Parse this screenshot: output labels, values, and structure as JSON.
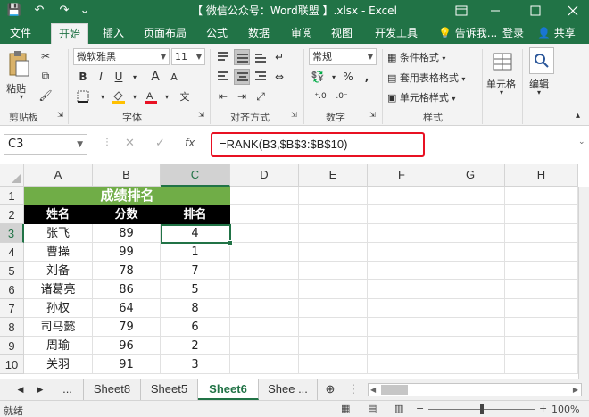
{
  "titlebar": {
    "title": "【 微信公众号：Word联盟 】.xlsx - Excel",
    "qa_save": "💾",
    "qa_undo": "↶",
    "qa_redo": "↷",
    "qa_custom": "⌄"
  },
  "tabs": [
    "文件",
    "开始",
    "插入",
    "页面布局",
    "公式",
    "数据",
    "审阅",
    "视图",
    "开发工具"
  ],
  "active_tab": "开始",
  "tell_me": "告诉我...",
  "login": "登录",
  "share": "共享",
  "ribbon": {
    "clipboard": {
      "paste": "粘贴",
      "label": "剪贴板"
    },
    "font": {
      "name": "微软雅黑",
      "size": "11",
      "label": "字体"
    },
    "alignment": {
      "label": "对齐方式"
    },
    "number": {
      "format": "常规",
      "percent": "%",
      "comma": ",",
      "label": "数字"
    },
    "styles": {
      "conditional": "条件格式",
      "table": "套用表格格式",
      "cell_styles": "单元格样式",
      "label": "样式"
    },
    "cells": {
      "label": "单元格"
    },
    "editing": {
      "label": "编辑"
    }
  },
  "formula_bar": {
    "name_box": "C3",
    "formula": "=RANK(B3,$B$3:$B$10)",
    "fx": "fx",
    "cancel": "✕",
    "enter": "✓"
  },
  "columns": [
    "A",
    "B",
    "C",
    "D",
    "E",
    "F",
    "G",
    "H"
  ],
  "rows": [
    "1",
    "2",
    "3",
    "4",
    "5",
    "6",
    "7",
    "8",
    "9",
    "10"
  ],
  "sheet": {
    "title": "成绩排名",
    "headers": [
      "姓名",
      "分数",
      "排名"
    ],
    "records": [
      [
        "张飞",
        "89",
        "4"
      ],
      [
        "曹操",
        "99",
        "1"
      ],
      [
        "刘备",
        "78",
        "7"
      ],
      [
        "诸葛亮",
        "86",
        "5"
      ],
      [
        "孙权",
        "64",
        "8"
      ],
      [
        "司马懿",
        "79",
        "6"
      ],
      [
        "周瑜",
        "96",
        "2"
      ],
      [
        "关羽",
        "91",
        "3"
      ]
    ]
  },
  "sheet_tabs": [
    "...",
    "Sheet8",
    "Sheet5",
    "Sheet6",
    "Shee ..."
  ],
  "active_sheet": "Sheet6",
  "status": {
    "ready": "就绪",
    "zoom": "100%"
  },
  "colors": {
    "excel_green": "#217346",
    "title_fill": "#70ad47",
    "header_fill": "#000000",
    "highlight": "#e81123"
  }
}
